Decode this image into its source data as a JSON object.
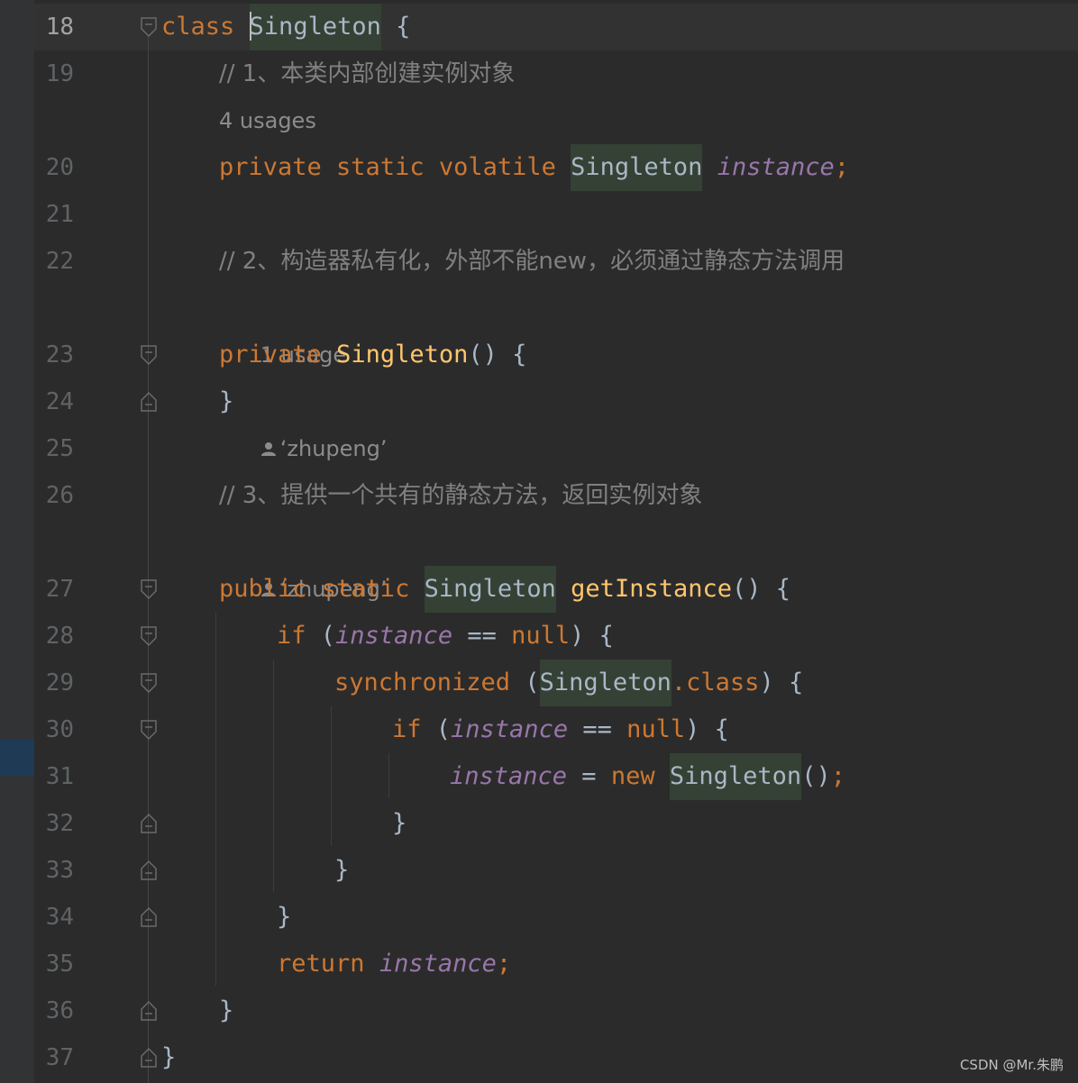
{
  "editor": {
    "lines": [
      {
        "n": "18",
        "kw1": "class",
        "cls": "Singleton",
        "rest": " {"
      },
      {
        "n": "19",
        "comment": "// 1、本类内部创建实例对象"
      },
      {
        "inlay": "4 usages"
      },
      {
        "n": "20",
        "kw1": "private static volatile",
        "cls": "Singleton",
        "field": "instance",
        "semi": ";"
      },
      {
        "n": "21"
      },
      {
        "n": "22",
        "comment": "// 2、构造器私有化，外部不能new，必须通过静态方法调用"
      },
      {
        "inlay": "1 usage",
        "author": "‘zhupeng’"
      },
      {
        "n": "23",
        "kw1": "private",
        "fn": "Singleton",
        "rest": "() {"
      },
      {
        "n": "24",
        "rest": "}"
      },
      {
        "n": "25"
      },
      {
        "n": "26",
        "comment": "// 3、提供一个共有的静态方法，返回实例对象"
      },
      {
        "author": "‘zhupeng’"
      },
      {
        "n": "27",
        "kw1": "public static",
        "cls": "Singleton",
        "fn": "getInstance",
        "rest": "() {"
      },
      {
        "n": "28",
        "kw1": "if",
        "p1": " (",
        "field": "instance",
        "op": " == ",
        "kw2": "null",
        "rest": ") {"
      },
      {
        "n": "29",
        "kw1": "synchronized",
        "p1": " (",
        "cls": "Singleton",
        "kw2": ".class",
        "rest": ") {"
      },
      {
        "n": "30",
        "kw1": "if",
        "p1": " (",
        "field": "instance",
        "op": " == ",
        "kw2": "null",
        "rest": ") {"
      },
      {
        "n": "31",
        "field": "instance",
        "op": " = ",
        "kw1": "new",
        "cls": "Singleton",
        "rest": "()",
        "semi": ";"
      },
      {
        "n": "32",
        "rest": "}"
      },
      {
        "n": "33",
        "rest": "}"
      },
      {
        "n": "34",
        "rest": "}"
      },
      {
        "n": "35",
        "kw1": "return",
        "field": "instance",
        "semi": ";"
      },
      {
        "n": "36",
        "rest": "}"
      },
      {
        "n": "37",
        "rest": "}"
      }
    ]
  },
  "watermark": "CSDN @Mr.朱鹏",
  "colors": {
    "background": "#2b2b2b",
    "keyword": "#cc7832",
    "comment": "#808080",
    "field": "#9876aa",
    "method": "#ffc66d",
    "text": "#a9b7c6",
    "highlight": "#344134"
  }
}
